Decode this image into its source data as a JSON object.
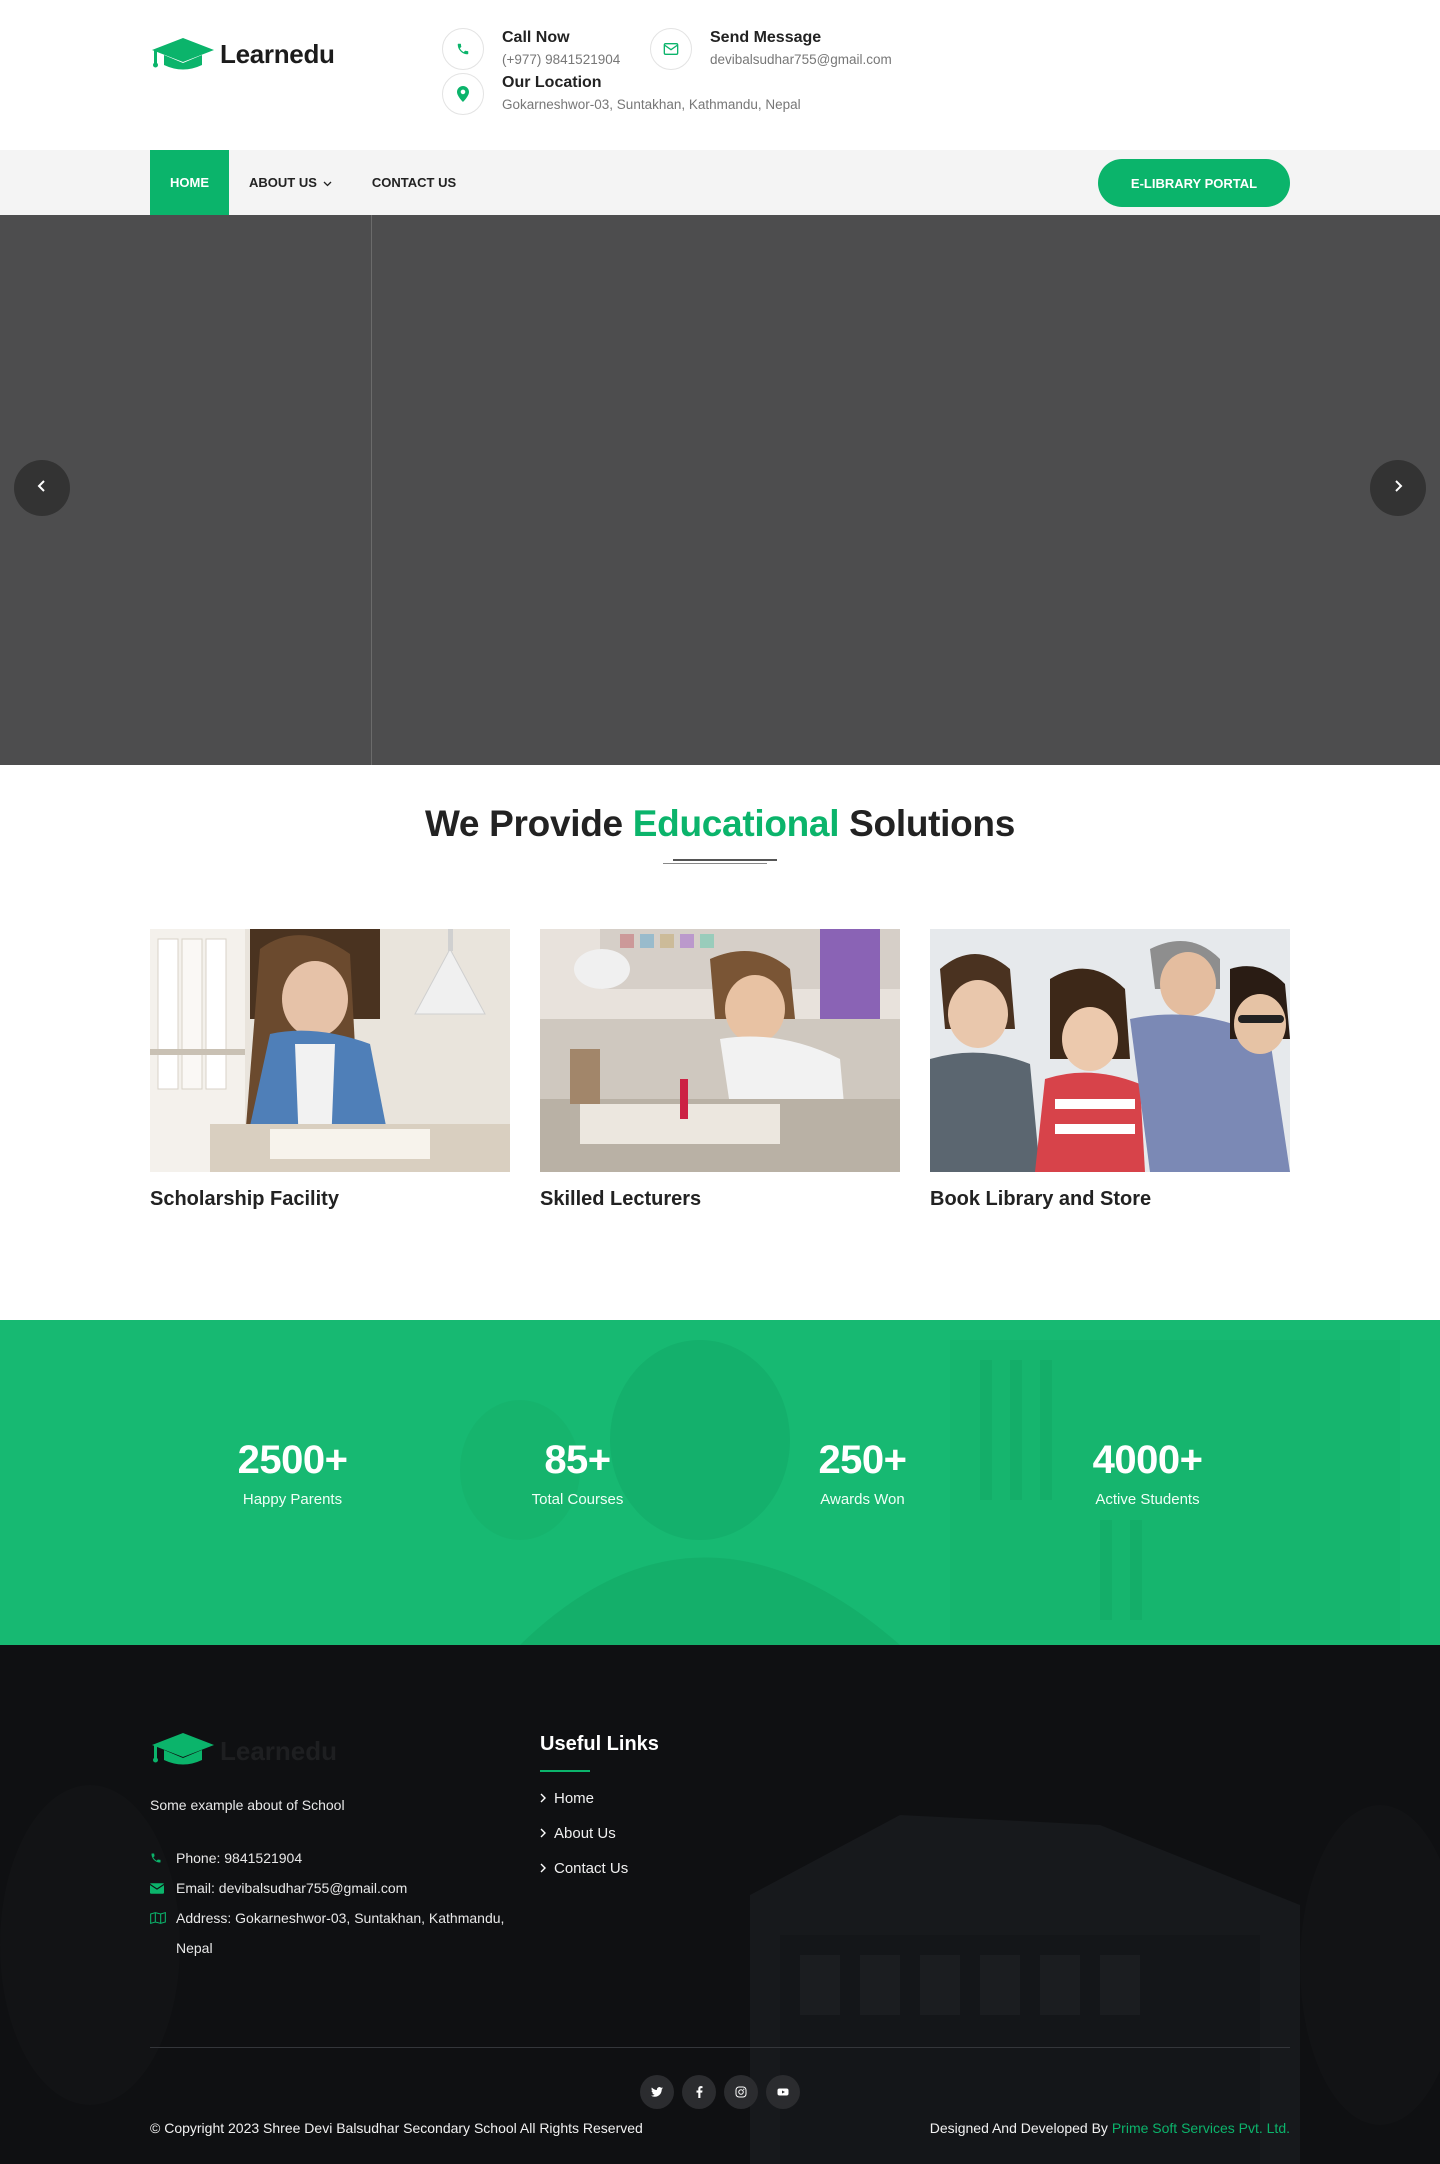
{
  "brand": {
    "name": "Learnedu",
    "accent": "#0bb46b"
  },
  "header": {
    "call": {
      "title": "Call Now",
      "value": "(+977) 9841521904",
      "icon": "phone-icon"
    },
    "message": {
      "title": "Send Message",
      "value": "devibalsudhar755@gmail.com",
      "icon": "envelope-icon"
    },
    "location": {
      "title": "Our Location",
      "value": "Gokarneshwor-03, Suntakhan, Kathmandu, Nepal",
      "icon": "map-pin-icon"
    }
  },
  "nav": {
    "items": [
      {
        "label": "HOME",
        "active": true
      },
      {
        "label": "ABOUT US",
        "dropdown": true
      },
      {
        "label": "CONTACT US"
      }
    ],
    "portal_button": "E-LIBRARY PORTAL"
  },
  "hero": {
    "prev_icon": "chevron-left-icon",
    "next_icon": "chevron-right-icon"
  },
  "solutions": {
    "title_prefix": "We Provide",
    "title_highlight": "Educational",
    "title_suffix": "Solutions",
    "cards": [
      {
        "title": "Scholarship Facility"
      },
      {
        "title": "Skilled Lecturers"
      },
      {
        "title": "Book Library and Store"
      }
    ]
  },
  "counters": [
    {
      "number": "2500+",
      "label": "Happy Parents"
    },
    {
      "number": "85+",
      "label": "Total Courses"
    },
    {
      "number": "250+",
      "label": "Awards Won"
    },
    {
      "number": "4000+",
      "label": "Active Students"
    }
  ],
  "footer": {
    "about": "Some example about of School",
    "phone": "Phone: 9841521904",
    "email": "Email: devibalsudhar755@gmail.com",
    "address": "Address: Gokarneshwor-03, Suntakhan, Kathmandu, Nepal",
    "links_title": "Useful Links",
    "links": [
      "Home",
      "About Us",
      "Contact Us"
    ],
    "social": [
      "twitter-icon",
      "facebook-icon",
      "instagram-icon",
      "youtube-icon"
    ],
    "copyright": "© Copyright 2023 Shree Devi Balsudhar Secondary School All Rights Reserved",
    "credits_prefix": "Designed And Developed By",
    "credits_link": "Prime Soft Services Pvt. Ltd."
  }
}
